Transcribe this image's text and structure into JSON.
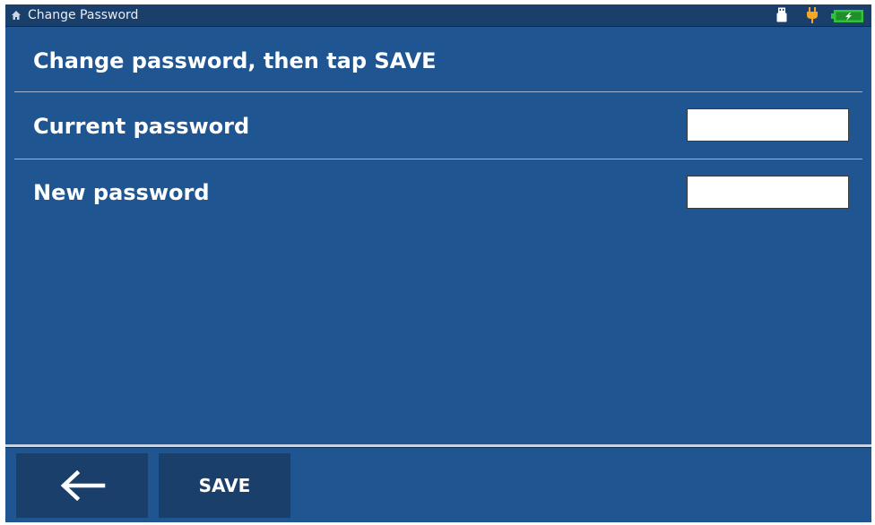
{
  "status_bar": {
    "title": "Change Password",
    "icons": [
      "home-icon",
      "usb-drive-icon",
      "power-plug-icon",
      "battery-charging-icon"
    ],
    "plug_color": "#f5a623",
    "battery_color": "#2fc23b"
  },
  "heading": "Change password, then tap SAVE",
  "fields": [
    {
      "label": "Current password",
      "value": "",
      "placeholder": ""
    },
    {
      "label": "New password",
      "value": "",
      "placeholder": ""
    }
  ],
  "buttons": {
    "back_icon": "arrow-left-icon",
    "save_label": "SAVE"
  },
  "colors": {
    "background": "#1f5591",
    "bar": "#1b3f6b"
  }
}
